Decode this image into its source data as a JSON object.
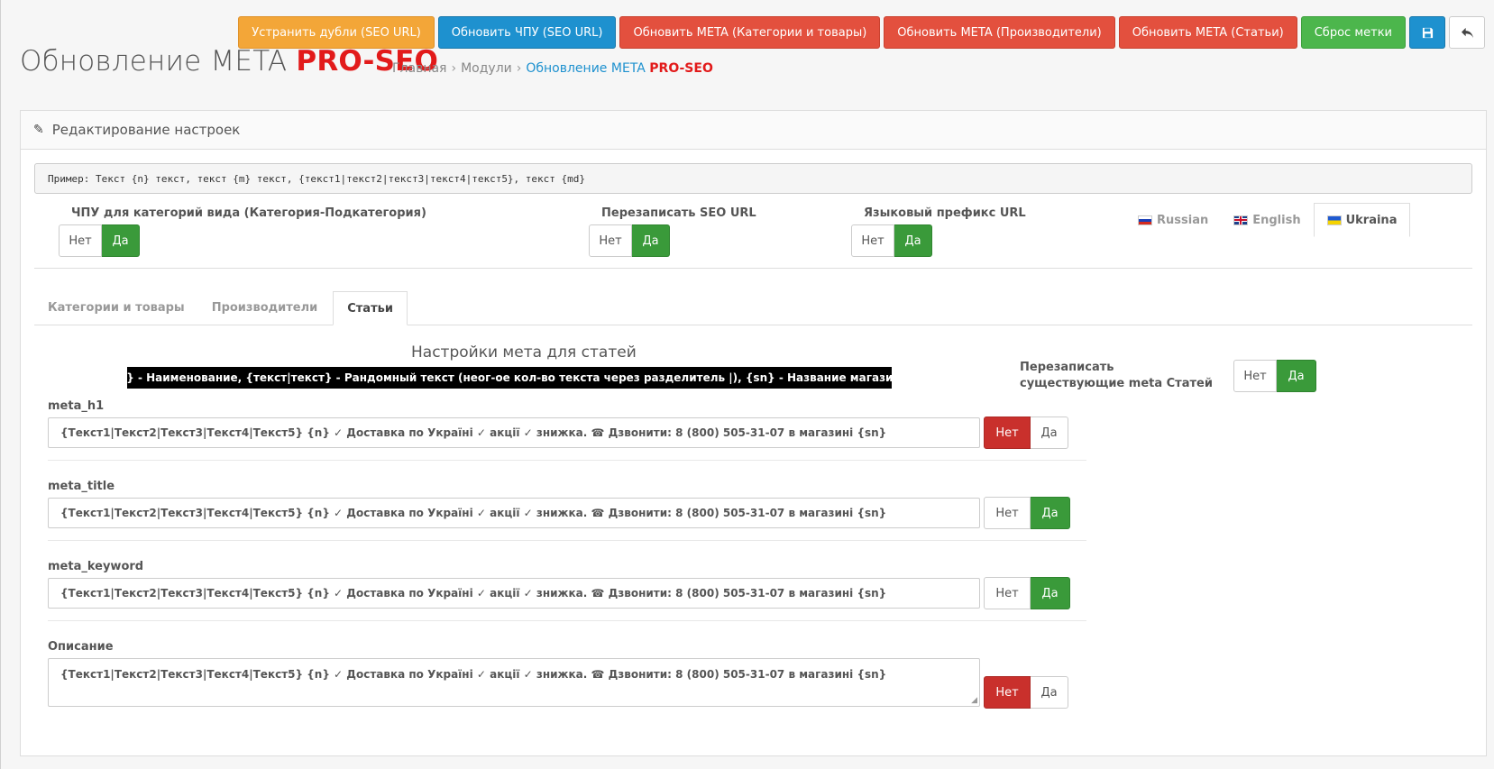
{
  "toolbar": {
    "fix_duplicates": "Устранить дубли (SEO URL)",
    "update_chpu": "Обновить ЧПУ (SEO URL)",
    "update_meta_categories": "Обновить META (Категории и товары)",
    "update_meta_manufacturers": "Обновить META (Производители)",
    "update_meta_articles": "Обновить META (Статьи)",
    "reset_marks": "Сброс метки",
    "save_icon": "save-icon",
    "back_icon": "reply-icon"
  },
  "header": {
    "title_main": "Обновление META",
    "title_accent": "PRO-SEO",
    "breadcrumb": {
      "home": "Главная",
      "modules": "Модули",
      "current_main": "Обновление META",
      "current_accent": "PRO-SEO",
      "separator": "›"
    }
  },
  "panel": {
    "heading": "Редактирование настроек",
    "example": "Пример: Текст {n} текст, текст {m} текст, {текст1|текст2|текст3|текст4|текст5}, текст {md}",
    "settings": {
      "chpu_label": "ЧПУ для категорий вида (Категория-Подкатегория)",
      "rewrite_seo_label": "Перезаписать SEO URL",
      "lang_prefix_label": "Языковый префикс URL",
      "no": "Нет",
      "yes": "Да"
    },
    "lang_tabs": [
      "Russian",
      "English",
      "Ukraina"
    ],
    "active_lang": "Ukraina",
    "main_tabs": [
      "Категории и товары",
      "Производители",
      "Статьи"
    ],
    "active_tab": "Статьи",
    "articles": {
      "section_title": "Настройки мета для статей",
      "legend": "{n} - Наименование, {текст|текст} - Рандомный текст (неог-ое кол-во текста через разделитель |), {sn} - Название магазина",
      "overwrite_label": "Перезаписать существующие meta Статей",
      "overwrite_value": "Да",
      "fields": [
        {
          "label": "meta_h1",
          "value": "{Текст1|Текст2|Текст3|Текст4|Текст5} {n} ✓ Доставка по Україні ✓ акції ✓ знижка. ☎ Дзвонити: 8 (800) 505-31-07 в магазині {sn}",
          "selected": "Нет"
        },
        {
          "label": "meta_title",
          "value": "{Текст1|Текст2|Текст3|Текст4|Текст5} {n} ✓ Доставка по Україні ✓ акції ✓ знижка. ☎ Дзвонити: 8 (800) 505-31-07 в магазині {sn}",
          "selected": "Да"
        },
        {
          "label": "meta_keyword",
          "value": "{Текст1|Текст2|Текст3|Текст4|Текст5} {n} ✓ Доставка по Україні ✓ акції ✓ знижка. ☎ Дзвонити: 8 (800) 505-31-07 в магазині {sn}",
          "selected": "Да"
        },
        {
          "label": "Описание",
          "value": "{Текст1|Текст2|Текст3|Текст4|Текст5} {n} ✓ Доставка по Україні ✓ акції ✓ знижка. ☎ Дзвонити: 8 (800) 505-31-07 в магазині {sn}",
          "selected": "Нет"
        }
      ]
    }
  },
  "colors": {
    "orange": "#f3a638",
    "blue": "#1e91cf",
    "red": "#e3503e",
    "green": "#4cb64c",
    "accent_red": "#e21a1a",
    "toggle_green": "#3a9a3a",
    "toggle_red": "#c9302c"
  }
}
